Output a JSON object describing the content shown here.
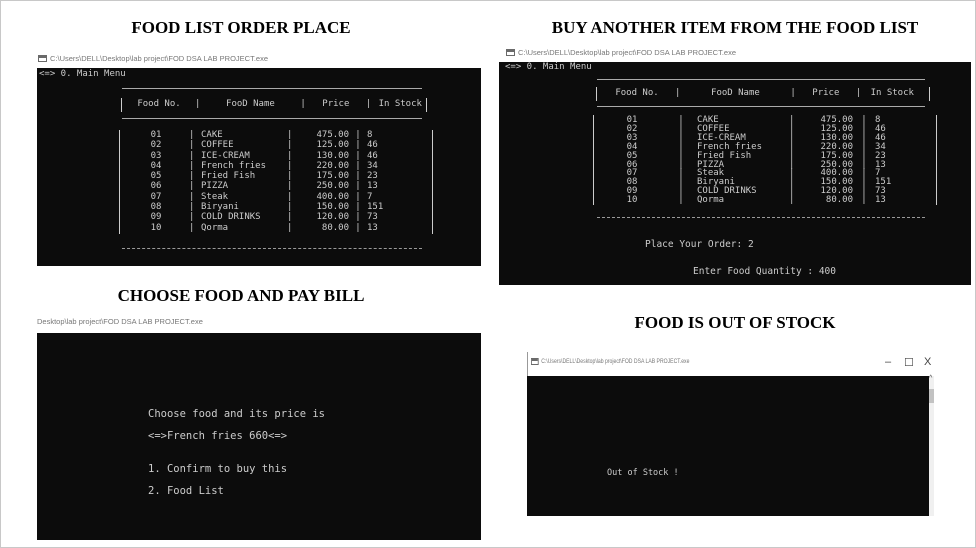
{
  "captions": {
    "top_left": "FOOD LIST ORDER PLACE",
    "top_right": "BUY ANOTHER ITEM FROM THE FOOD LIST",
    "bottom_left": "CHOOSE FOOD AND PAY BILL",
    "bottom_right": "FOOD IS OUT OF STOCK"
  },
  "paths": {
    "full": "C:\\Users\\DELL\\Desktop\\lab project\\FOD DSA LAB PROJECT.exe",
    "partial": "Desktop\\lab project\\FOD DSA LAB PROJECT.exe"
  },
  "console": {
    "main_menu": "<=> 0. Main Menu",
    "headers": [
      "Food No.",
      "FooD Name",
      "Price",
      "In Stock"
    ],
    "rows": [
      {
        "no": "01",
        "name": "CAKE",
        "price": "475.00",
        "stock": "8"
      },
      {
        "no": "02",
        "name": "COFFEE",
        "price": "125.00",
        "stock": "46"
      },
      {
        "no": "03",
        "name": "ICE-CREAM",
        "price": "130.00",
        "stock": "46"
      },
      {
        "no": "04",
        "name": "French fries",
        "price": "220.00",
        "stock": "34"
      },
      {
        "no": "05",
        "name": "Fried Fish",
        "price": "175.00",
        "stock": "23"
      },
      {
        "no": "06",
        "name": "PIZZA",
        "price": "250.00",
        "stock": "13"
      },
      {
        "no": "07",
        "name": "Steak",
        "price": "400.00",
        "stock": "7"
      },
      {
        "no": "08",
        "name": "Biryani",
        "price": "150.00",
        "stock": "151"
      },
      {
        "no": "09",
        "name": "COLD DRINKS",
        "price": "120.00",
        "stock": "73"
      },
      {
        "no": "10",
        "name": "Qorma",
        "price": "80.00",
        "stock": "13"
      }
    ],
    "place_order": "Place Your Order: 2",
    "enter_quantity": "Enter Food Quantity : 400",
    "choose_line": "Choose food and its price is",
    "selected": "<=>French fries 660<=>",
    "option_confirm": "1. Confirm to buy this",
    "option_list": "2. Food List",
    "out_of_stock": "Out of Stock !"
  },
  "window_controls": {
    "minimize": "–",
    "maximize": "☐",
    "close": "X",
    "scroll_up": "^"
  }
}
